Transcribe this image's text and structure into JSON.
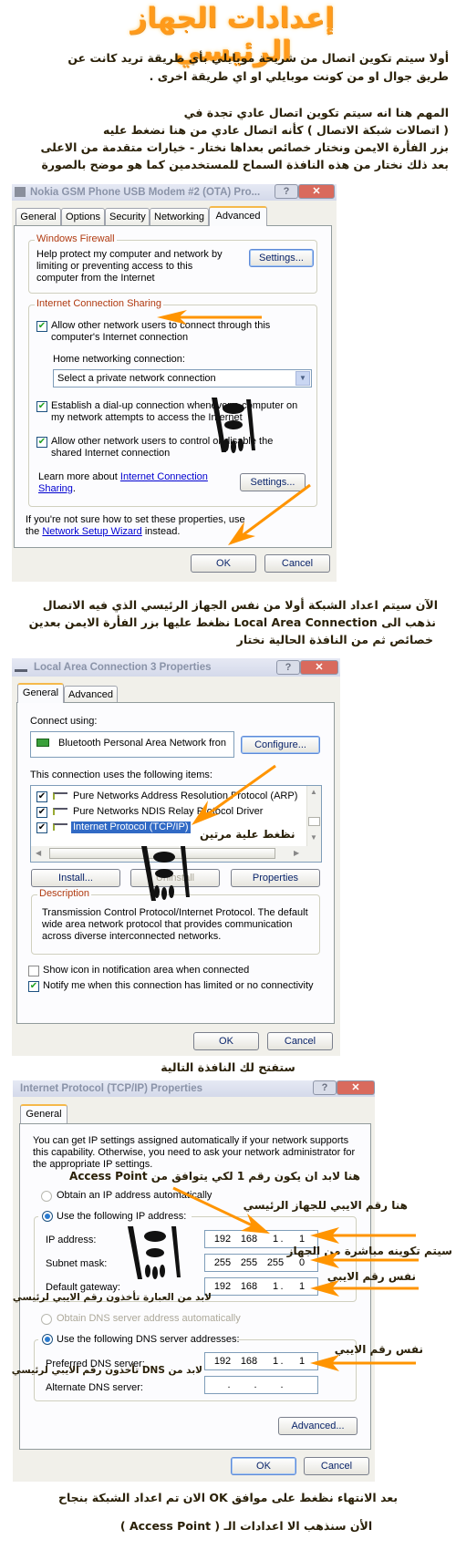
{
  "heading": "إعدادات الجهاز الرئيسي",
  "intro": [
    "أولا سيتم تكوين اتصال من شريحة موبايلي بأي طريقة تريد كانت عن",
    "طريق جوال او من كونت موبايلي او اي طريقة اخرى ."
  ],
  "intro2": [
    "المهم هنا انه سيتم تكوين اتصال عادي تجدة في",
    "( اتصالات شبكة الاتصال ) كأنه اتصال عادي من هنا نضغط عليه",
    "بزر الفأرة الايمن ونختار خصائص بعداها نختار - خيارات متقدمة من الاعلى",
    "بعد ذلك نختار من هذه النافذة السماح للمستخدمين كما هو موضح بالصورة"
  ],
  "dialog1": {
    "title": "Nokia GSM Phone USB Modem #2 (OTA) Pro...",
    "tabs": [
      "General",
      "Options",
      "Security",
      "Networking",
      "Advanced"
    ],
    "active_tab": "Advanced",
    "firewall": {
      "legend": "Windows Firewall",
      "text": [
        "Help protect my computer and network by",
        "limiting or preventing access to this",
        "computer from the Internet"
      ],
      "settings": "Settings..."
    },
    "ics": {
      "legend": "Internet Connection Sharing",
      "allow_connect": {
        "checked": true,
        "lines": [
          "Allow other network users to connect through this",
          "computer's Internet connection"
        ]
      },
      "home_label": "Home networking connection:",
      "home_select": "Select a private network connection",
      "dialup": {
        "checked": true,
        "lines": [
          "Establish a dial-up connection whenever a computer on",
          "my network attempts to access the Internet"
        ]
      },
      "allow_control": {
        "checked": true,
        "lines": [
          "Allow other network users to control or disable the",
          "shared Internet connection"
        ]
      },
      "learn_prefix": "Learn more about ",
      "learn_link1": "Internet Connection",
      "learn_link2": "Sharing",
      "learn_suffix": ".",
      "settings": "Settings..."
    },
    "footer_prefix": "If you're not sure how to set these properties, use",
    "footer_the": "the ",
    "footer_link": "Network Setup Wizard",
    "footer_suffix": " instead.",
    "ok": "OK",
    "cancel": "Cancel"
  },
  "step2": [
    "الآن سيتم اعداد الشبكة أولا من نفس الجهاز الرئيسي الذي فيه الاتصال",
    "نذهب الى Local Area Connection نظغط عليها بزر الفأرة الايمن بعدين",
    "خصائص ثم من النافذة الحالية نختار"
  ],
  "dialog2": {
    "title": "Local Area Connection 3 Properties",
    "tabs": [
      "General",
      "Advanced"
    ],
    "active_tab": "General",
    "connect_using": "Connect using:",
    "adapter": "Bluetooth Personal Area Network fron",
    "configure": "Configure...",
    "items_label": "This connection uses the following items:",
    "items": [
      {
        "label": "Pure Networks Address Resolution Protocol (ARP)",
        "checked": true,
        "selected": false
      },
      {
        "label": "Pure Networks NDIS Relay Protocol Driver",
        "checked": true,
        "selected": false
      },
      {
        "label": "Internet Protocol (TCP/IP)",
        "checked": true,
        "selected": true
      }
    ],
    "annotation": "نظغط علية مرتين",
    "install": "Install...",
    "uninstall": "Uninstall",
    "properties": "Properties",
    "description_legend": "Description",
    "description": [
      "Transmission Control Protocol/Internet Protocol. The default",
      "wide area network protocol that provides communication",
      "across diverse interconnected networks."
    ],
    "show_icon": {
      "label": "Show icon in notification area when connected",
      "checked": false
    },
    "notify": {
      "label": "Notify me when this connection has limited or no connectivity",
      "checked": true
    },
    "ok": "OK",
    "cancel": "Cancel"
  },
  "step3": "ستفتح لك النافذة التالية",
  "dialog3": {
    "title": "Internet Protocol (TCP/IP) Properties",
    "tab": "General",
    "intro": [
      "You can get IP settings assigned automatically if your network supports",
      "this capability. Otherwise, you need to ask your network administrator for",
      "the appropriate IP settings."
    ],
    "obtain_ip": "Obtain an IP address automatically",
    "use_ip": "Use the following IP address:",
    "ip_label": "IP address:",
    "ip": [
      "192",
      "168",
      "1",
      "1"
    ],
    "mask_label": "Subnet mask:",
    "mask": [
      "255",
      "255",
      "255",
      "0"
    ],
    "gw_label": "Default gateway:",
    "gw": [
      "192",
      "168",
      "1",
      "1"
    ],
    "obtain_dns": "Obtain DNS server address automatically",
    "use_dns": "Use the following DNS server addresses:",
    "pdns_label": "Preferred DNS server:",
    "pdns": [
      "192",
      "168",
      "1",
      "1"
    ],
    "adns_label": "Alternate DNS server:",
    "advanced": "Advanced...",
    "ok": "OK",
    "cancel": "Cancel",
    "notes": {
      "access_point": "هنا لابد ان يكون رقم 1 لكي يتوافق من Access Point",
      "main_ip": "هنا رقم الايبي للجهاز الرئيسي",
      "auto": "سيتم تكوينه مباشرة من الجهاز",
      "same_ip": "نفس رقم الايبي",
      "gw_note": "لابد من العبارة تأخذون رقم الايبي لرئيسي",
      "same_ip2": "نفس رقم الايبي",
      "dns_note": "لابد من DNS تأخذون رقم الايبي لرئيسي"
    }
  },
  "closing": [
    "بعد الانتهاء نظغط على موافق OK الان تم اعداد الشبكة بنجاح",
    "الأن سنذهب الا اعدادات الـ ( Access Point )"
  ],
  "colors": {
    "arrow": "#ff9400",
    "heading": "#ff9a1a",
    "legend": "#b03a10",
    "selection": "#316ac5"
  }
}
